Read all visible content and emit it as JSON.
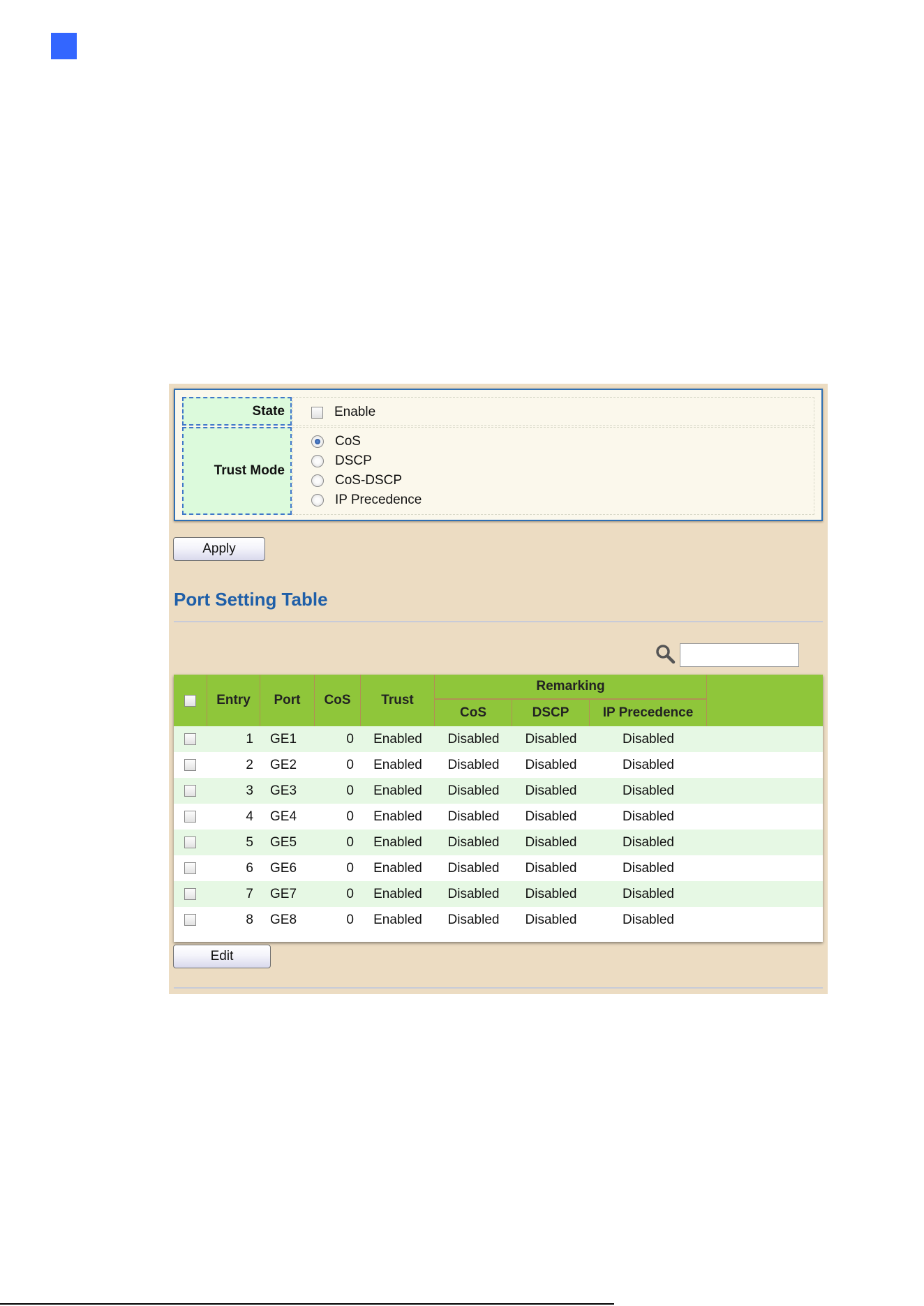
{
  "settings": {
    "state_label": "State",
    "state_option": "Enable",
    "state_checked": false,
    "trust_mode_label": "Trust Mode",
    "trust_options": [
      {
        "label": "CoS",
        "selected": true
      },
      {
        "label": "DSCP",
        "selected": false
      },
      {
        "label": "CoS-DSCP",
        "selected": false
      },
      {
        "label": "IP Precedence",
        "selected": false
      }
    ],
    "apply_label": "Apply"
  },
  "table": {
    "title": "Port Setting Table",
    "search_value": "",
    "headers": {
      "entry": "Entry",
      "port": "Port",
      "cos": "CoS",
      "trust": "Trust",
      "remarking": "Remarking",
      "remark_cos": "CoS",
      "remark_dscp": "DSCP",
      "remark_ip_precedence": "IP Precedence"
    },
    "rows": [
      {
        "entry": "1",
        "port": "GE1",
        "cos": "0",
        "trust": "Enabled",
        "remark_cos": "Disabled",
        "remark_dscp": "Disabled",
        "remark_ip": "Disabled"
      },
      {
        "entry": "2",
        "port": "GE2",
        "cos": "0",
        "trust": "Enabled",
        "remark_cos": "Disabled",
        "remark_dscp": "Disabled",
        "remark_ip": "Disabled"
      },
      {
        "entry": "3",
        "port": "GE3",
        "cos": "0",
        "trust": "Enabled",
        "remark_cos": "Disabled",
        "remark_dscp": "Disabled",
        "remark_ip": "Disabled"
      },
      {
        "entry": "4",
        "port": "GE4",
        "cos": "0",
        "trust": "Enabled",
        "remark_cos": "Disabled",
        "remark_dscp": "Disabled",
        "remark_ip": "Disabled"
      },
      {
        "entry": "5",
        "port": "GE5",
        "cos": "0",
        "trust": "Enabled",
        "remark_cos": "Disabled",
        "remark_dscp": "Disabled",
        "remark_ip": "Disabled"
      },
      {
        "entry": "6",
        "port": "GE6",
        "cos": "0",
        "trust": "Enabled",
        "remark_cos": "Disabled",
        "remark_dscp": "Disabled",
        "remark_ip": "Disabled"
      },
      {
        "entry": "7",
        "port": "GE7",
        "cos": "0",
        "trust": "Enabled",
        "remark_cos": "Disabled",
        "remark_dscp": "Disabled",
        "remark_ip": "Disabled"
      },
      {
        "entry": "8",
        "port": "GE8",
        "cos": "0",
        "trust": "Enabled",
        "remark_cos": "Disabled",
        "remark_dscp": "Disabled",
        "remark_ip": "Disabled"
      }
    ],
    "edit_label": "Edit"
  },
  "colors": {
    "header_green": "#8fc63a",
    "row_stripe": "#e6f8e4",
    "title_blue": "#1f5fa8",
    "panel_bg": "#ecdcc2",
    "corner_marker": "#3366ff"
  }
}
